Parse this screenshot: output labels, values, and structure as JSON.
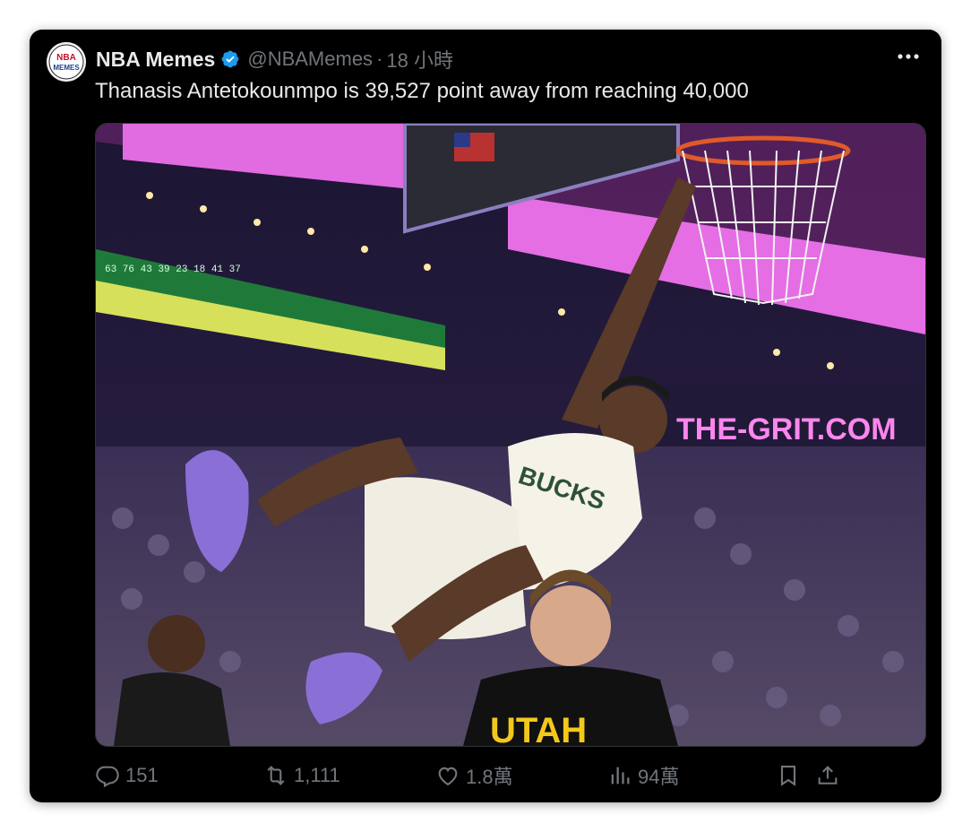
{
  "author": {
    "display_name": "NBA Memes",
    "handle": "@NBAMemes",
    "separator": "·",
    "time": "18 小時",
    "avatar_text_top": "NBA",
    "avatar_text_bottom": "MEMES"
  },
  "tweet": {
    "text": "Thanasis Antetokounmpo is 39,527 point away from reaching 40,000"
  },
  "media": {
    "scoreboard_sign": "THE-GRIT.COM",
    "jersey_front": "BUCKS",
    "jersey_back": "UTAH"
  },
  "actions": {
    "replies": "151",
    "retweets": "1,111",
    "likes": "1.8萬",
    "views": "94萬"
  },
  "icons": [
    "verified-icon",
    "more-icon",
    "reply-icon",
    "retweet-icon",
    "like-icon",
    "views-icon",
    "bookmark-icon",
    "share-icon"
  ],
  "colors": {
    "background": "#000000",
    "text": "#e7e9ea",
    "muted": "#71767b",
    "verified": "#1d9bf0"
  }
}
